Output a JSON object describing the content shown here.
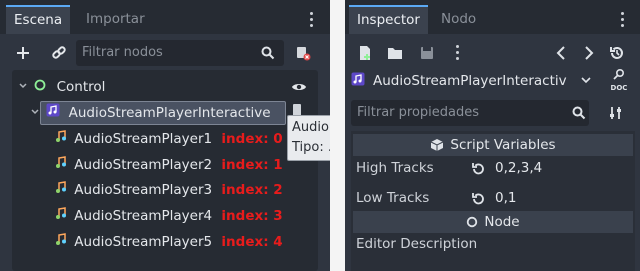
{
  "scene_panel": {
    "tabs": [
      {
        "label": "Escena",
        "active": true
      },
      {
        "label": "Importar",
        "active": false
      }
    ],
    "filter": {
      "placeholder": "Filtrar nodos"
    },
    "tree": {
      "root": {
        "label": "Control",
        "icon": "control-circle-icon"
      },
      "selected": {
        "label": "AudioStreamPlayerInteractive",
        "icon": "audio-interactive-icon"
      },
      "children": [
        {
          "label": "AudioStreamPlayer1",
          "index_label": "index: 0"
        },
        {
          "label": "AudioStreamPlayer2",
          "index_label": "index: 1"
        },
        {
          "label": "AudioStreamPlayer3",
          "index_label": "index: 2"
        },
        {
          "label": "AudioStreamPlayer4",
          "index_label": "index: 3"
        },
        {
          "label": "AudioStreamPlayer5",
          "index_label": "index: 4"
        }
      ]
    },
    "tooltip": {
      "line1": "Audio",
      "line2": "Tipo: ."
    }
  },
  "inspector_panel": {
    "tabs": [
      {
        "label": "Inspector",
        "active": true
      },
      {
        "label": "Nodo",
        "active": false
      }
    ],
    "object_name": "AudioStreamPlayerInteractiv",
    "doc_label": "DOC",
    "filter": {
      "placeholder": "Filtrar propiedades"
    },
    "sections": {
      "script_variables": "Script Variables",
      "node": "Node"
    },
    "properties": [
      {
        "label": "High Tracks",
        "value": "0,2,3,4"
      },
      {
        "label": "Low Tracks",
        "value": "0,1"
      }
    ],
    "editor_description": "Editor Description"
  },
  "colors": {
    "panel_bg": "#2f3540",
    "tab_bar_bg": "#262b33",
    "accent": "#5ba9f4",
    "index_red": "#e81c1c",
    "control_green": "#8eef97",
    "audio_purple": "#a582ff"
  }
}
